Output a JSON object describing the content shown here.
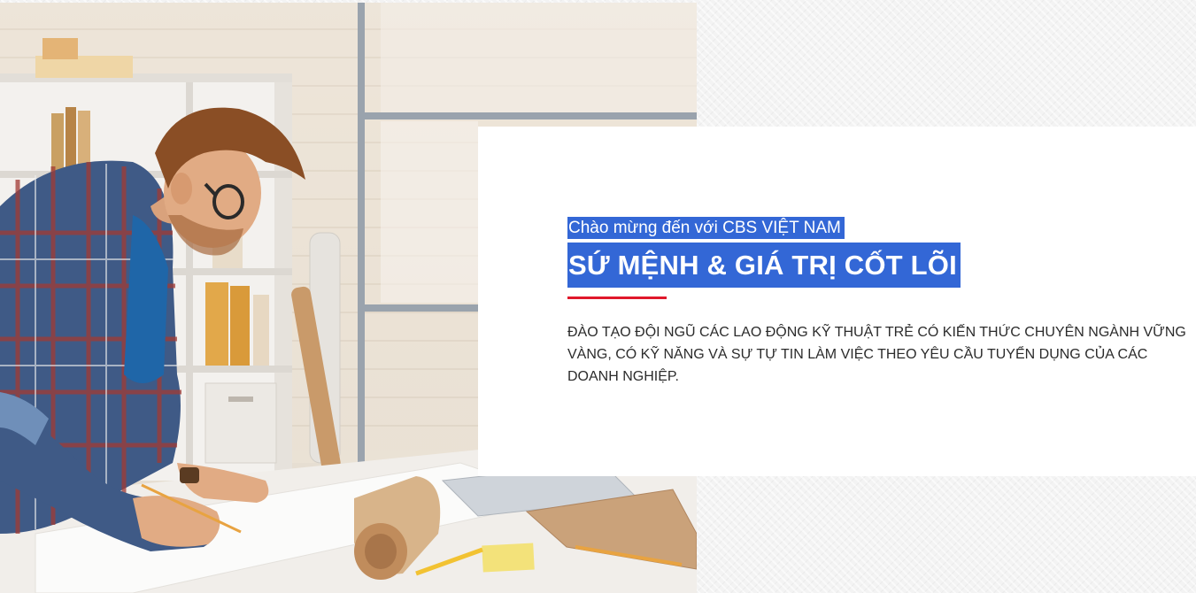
{
  "hero": {
    "photo_alt": "Man drafting plans at a desk",
    "welcome_text": "Chào mừng đến với CBS VIỆT NAM",
    "title": "SỨ MỆNH & GIÁ TRỊ CỐT LÕI",
    "mission_text": "ĐÀO TẠO ĐỘI NGŨ CÁC LAO ĐỘNG KỸ THUẬT TRẺ CÓ KIẾN THỨC CHUYÊN NGÀNH VỮNG VÀNG, CÓ KỸ NĂNG VÀ SỰ TỰ TIN LÀM VIỆC THEO YÊU CẦU TUYỂN DỤNG CỦA CÁC DOANH NGHIỆP."
  },
  "colors": {
    "highlight": "#3367d6",
    "accent_line": "#e0182b",
    "body_text": "#2b2b2b",
    "card_bg": "#ffffff"
  }
}
